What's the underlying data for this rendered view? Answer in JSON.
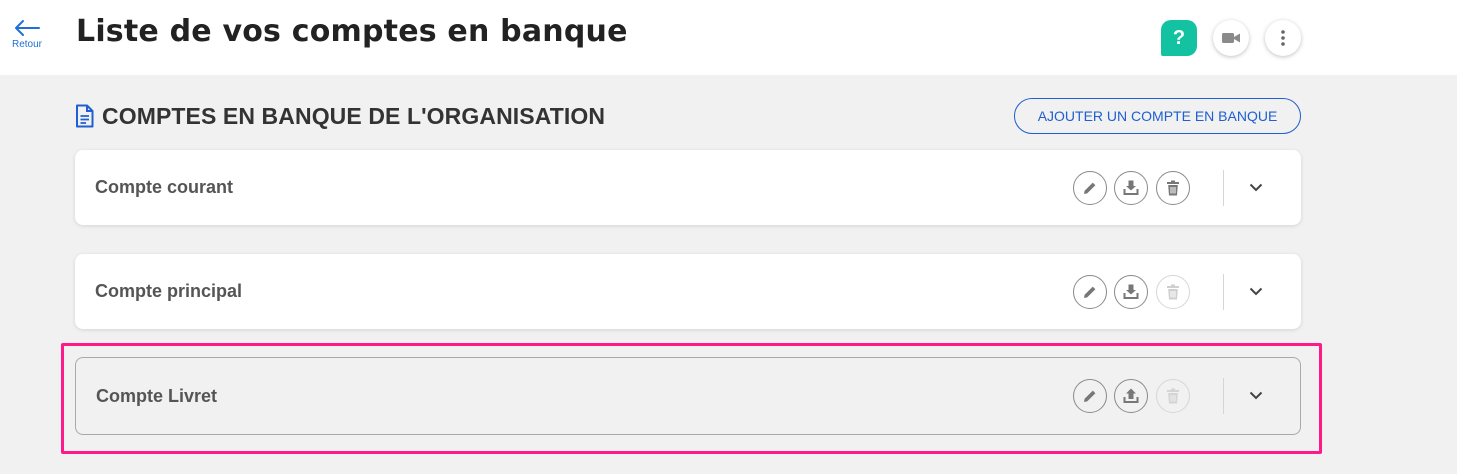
{
  "header": {
    "back_label": "Retour",
    "title": "Liste de vos comptes en banque",
    "help_label": "?",
    "icons": {
      "back": "arrow-left-icon",
      "help": "question-icon",
      "video": "video-camera-icon",
      "more": "more-vertical-icon"
    }
  },
  "section": {
    "title": "COMPTES EN BANQUE DE L'ORGANISATION",
    "icon": "document-icon",
    "add_button": "AJOUTER UN COMPTE EN BANQUE"
  },
  "accounts": [
    {
      "name": "Compte courant",
      "delete_enabled": true,
      "transfer_icon": "download-icon"
    },
    {
      "name": "Compte principal",
      "delete_enabled": false,
      "transfer_icon": "download-icon"
    },
    {
      "name": "Compte Livret",
      "delete_enabled": false,
      "transfer_icon": "upload-icon",
      "highlighted": true
    }
  ],
  "colors": {
    "accent": "#1f5fd1",
    "help": "#13c2a0",
    "highlight": "#ff1a8c",
    "background": "#f1f1f1"
  }
}
